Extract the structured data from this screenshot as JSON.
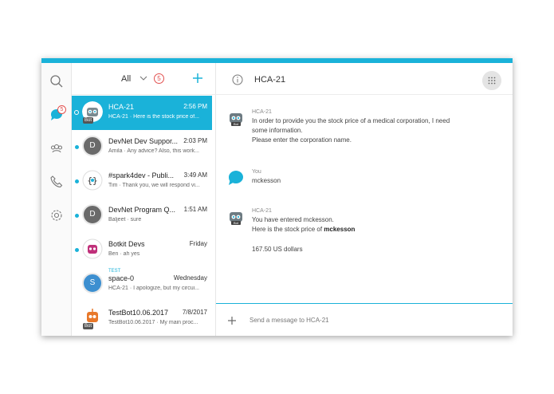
{
  "colors": {
    "accent": "#1ab2d9",
    "badge": "#e2504f"
  },
  "rail": {
    "search_icon": "search-icon",
    "messages_badge": "5",
    "items": [
      "messages-icon",
      "teams-icon",
      "calls-icon",
      "settings-icon"
    ]
  },
  "list": {
    "filter": "All",
    "unread_count": "5",
    "rows": [
      {
        "name": "HCA-21",
        "time": "2:56 PM",
        "preview": "HCA-21 · Here is the stock price of...",
        "avatar": "bot",
        "bot": "Bot",
        "active": true
      },
      {
        "name": "DevNet Dev Suppor...",
        "time": "2:03 PM",
        "preview": "Amila · Any advice? Also, this work...",
        "avatar": "D"
      },
      {
        "name": "#spark4dev - Publi...",
        "time": "3:49 AM",
        "preview": "Tim · Thank you, we will respond vi...",
        "avatar": "braces"
      },
      {
        "name": "DevNet Program Q...",
        "time": "1:51 AM",
        "preview": "Baljeet · sure",
        "avatar": "D"
      },
      {
        "name": "Botkit Devs",
        "time": "Friday",
        "preview": "Ben · ah yes",
        "avatar": "botkit"
      },
      {
        "name": "space-0",
        "time": "Wednesday",
        "preview": "HCA-21 · I apologize, but my circui...",
        "avatar": "S",
        "tag": "TEST"
      },
      {
        "name": "TestBot10.06.2017",
        "time": "7/8/2017",
        "preview": "TestBot10.06.2017 · My main proc...",
        "avatar": "orangebot",
        "bot": "Bot"
      }
    ]
  },
  "chat": {
    "title": "HCA-21",
    "messages": [
      {
        "sender": "HCA-21",
        "avatar": "bot",
        "lines": [
          "In order to provide you the stock price of a medical corporation, I need",
          "some information.",
          "Please enter the corporation name."
        ]
      },
      {
        "sender": "You",
        "avatar": "you",
        "lines": [
          "mckesson"
        ]
      },
      {
        "sender": "HCA-21",
        "avatar": "bot",
        "lines": [
          "You have entered mckesson.",
          "Here is the stock price of",
          "167.50 US dollars"
        ],
        "bold": "mckesson"
      }
    ],
    "composer_placeholder": "Send a message to HCA-21"
  }
}
